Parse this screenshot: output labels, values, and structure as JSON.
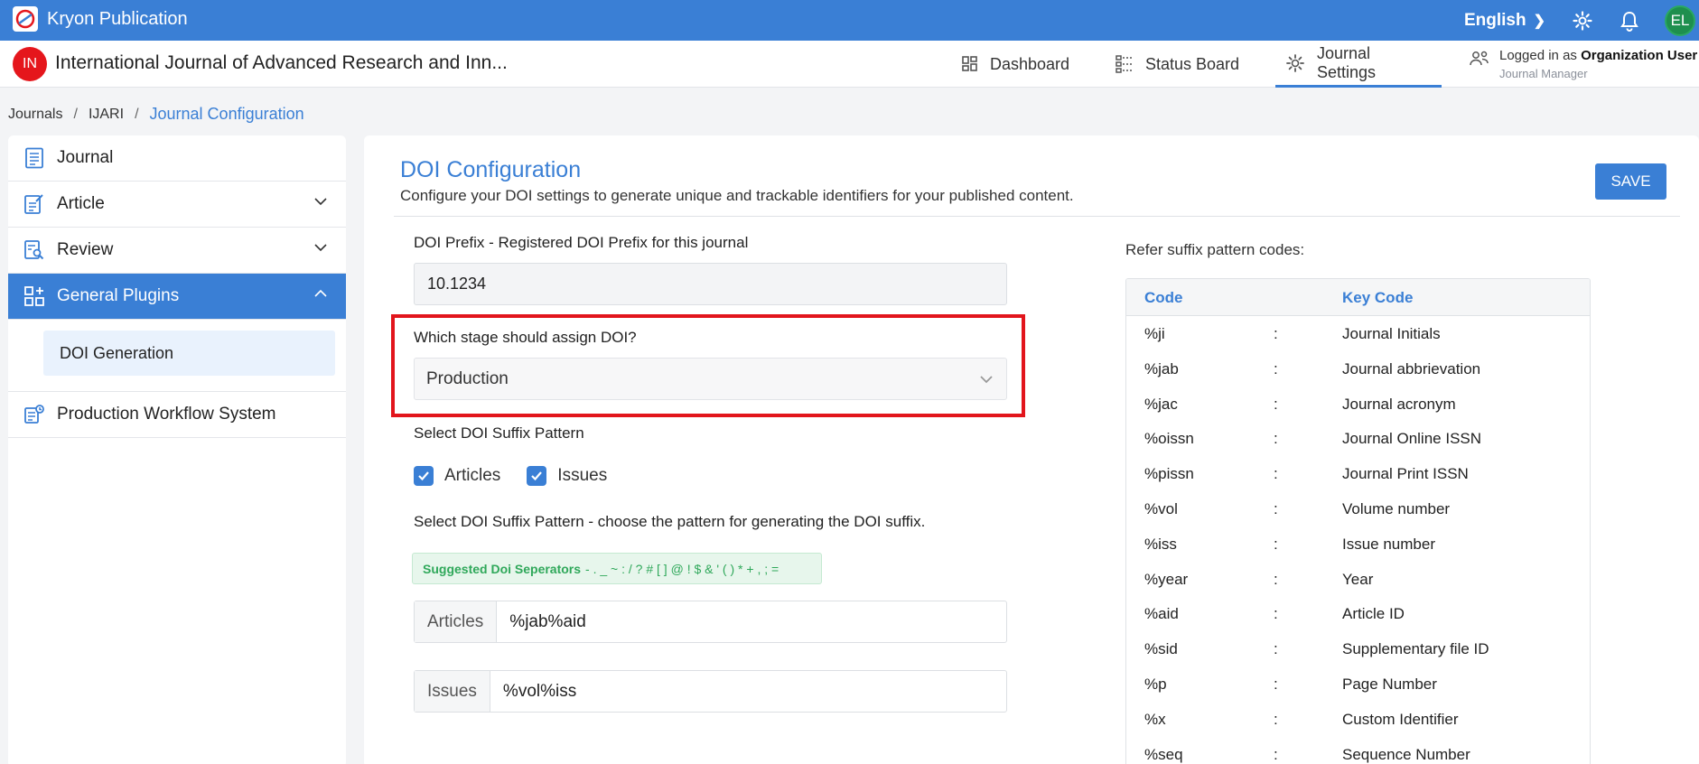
{
  "app": {
    "name": "Kryon Publication"
  },
  "topbar": {
    "language": "English",
    "avatar_initials": "EL"
  },
  "journal": {
    "badge": "IN",
    "title": "International Journal of Advanced Research and Inn..."
  },
  "nav": [
    {
      "label": "Dashboard"
    },
    {
      "label": "Status Board"
    },
    {
      "label": "Journal Settings"
    }
  ],
  "user": {
    "logged_prefix": "Logged in as",
    "name": "Organization User",
    "role": "Journal Manager"
  },
  "breadcrumb": [
    "Journals",
    "IJARI",
    "Journal Configuration"
  ],
  "sidebar": {
    "items": [
      {
        "label": "Journal"
      },
      {
        "label": "Article"
      },
      {
        "label": "Review"
      },
      {
        "label": "General Plugins"
      },
      {
        "label": "DOI Generation"
      },
      {
        "label": "Production Workflow System"
      }
    ]
  },
  "main": {
    "title": "DOI Configuration",
    "description": "Configure your DOI settings to generate unique and trackable identifiers for your published content.",
    "save_label": "SAVE",
    "prefix_label": "DOI Prefix - Registered DOI Prefix for this journal",
    "prefix_value": "10.1234",
    "stage_label": "Which stage should assign DOI?",
    "stage_value": "Production",
    "suffix_label": "Select DOI Suffix Pattern",
    "checkboxes": [
      {
        "label": "Articles",
        "checked": true
      },
      {
        "label": "Issues",
        "checked": true
      }
    ],
    "pattern_label": "Select DOI Suffix Pattern - choose the pattern for generating the DOI suffix.",
    "separators_label": "Suggested Doi Seperators",
    "separators_value": "- . _ ~ : / ? # [ ] @ ! $ & ' ( ) * + , ; =",
    "articles_label": "Articles",
    "articles_value": "%jab%aid",
    "issues_label": "Issues",
    "issues_value": "%vol%iss"
  },
  "reference": {
    "title": "Refer suffix pattern codes:",
    "headers": [
      "Code",
      "Key Code"
    ],
    "separator": ":",
    "rows": [
      {
        "code": "%ji",
        "desc": "Journal Initials"
      },
      {
        "code": "%jab",
        "desc": "Journal abbrievation"
      },
      {
        "code": "%jac",
        "desc": "Journal acronym"
      },
      {
        "code": "%oissn",
        "desc": "Journal Online ISSN"
      },
      {
        "code": "%pissn",
        "desc": "Journal Print ISSN"
      },
      {
        "code": "%vol",
        "desc": "Volume number"
      },
      {
        "code": "%iss",
        "desc": "Issue number"
      },
      {
        "code": "%year",
        "desc": "Year"
      },
      {
        "code": "%aid",
        "desc": "Article ID"
      },
      {
        "code": "%sid",
        "desc": "Supplementary file ID"
      },
      {
        "code": "%p",
        "desc": "Page Number"
      },
      {
        "code": "%x",
        "desc": "Custom Identifier"
      },
      {
        "code": "%seq",
        "desc": "Sequence Number"
      }
    ]
  },
  "colors": {
    "accent": "#3a7fd5",
    "highlight": "#e2151c",
    "success": "#2fa85a"
  }
}
